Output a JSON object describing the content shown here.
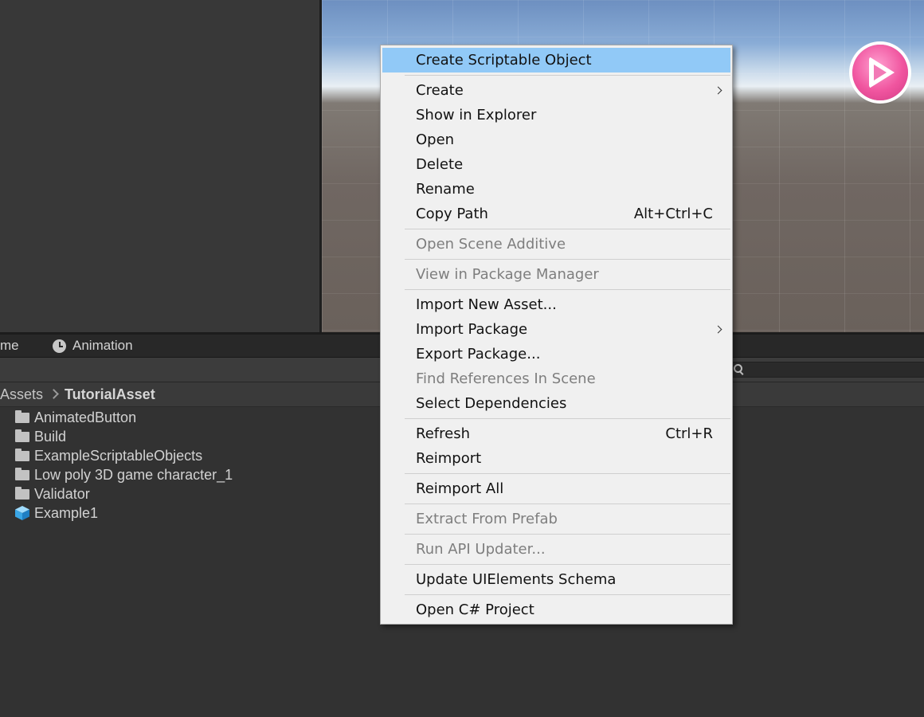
{
  "tabs": {
    "game_label": "me",
    "animation_label": "Animation"
  },
  "breadcrumb": {
    "root": "Assets",
    "current": "TutorialAsset"
  },
  "files": [
    {
      "label": "AnimatedButton",
      "icon": "folder-icon"
    },
    {
      "label": "Build",
      "icon": "folder-icon"
    },
    {
      "label": "ExampleScriptableObjects",
      "icon": "folder-icon"
    },
    {
      "label": "Low poly 3D game character_1",
      "icon": "folder-icon"
    },
    {
      "label": "Validator",
      "icon": "folder-icon"
    },
    {
      "label": "Example1",
      "icon": "cube-icon"
    }
  ],
  "context_menu": {
    "create_scriptable_object": "Create Scriptable Object",
    "create": "Create",
    "show_in_explorer": "Show in Explorer",
    "open": "Open",
    "delete": "Delete",
    "rename": "Rename",
    "copy_path": "Copy Path",
    "copy_path_shortcut": "Alt+Ctrl+C",
    "open_scene_additive": "Open Scene Additive",
    "view_in_package_manager": "View in Package Manager",
    "import_new_asset": "Import New Asset...",
    "import_package": "Import Package",
    "export_package": "Export Package...",
    "find_references_in_scene": "Find References In Scene",
    "select_dependencies": "Select Dependencies",
    "refresh": "Refresh",
    "refresh_shortcut": "Ctrl+R",
    "reimport": "Reimport",
    "reimport_all": "Reimport All",
    "extract_from_prefab": "Extract From Prefab",
    "run_api_updater": "Run API Updater...",
    "update_uielements_schema": "Update UIElements Schema",
    "open_csharp_project": "Open C# Project"
  },
  "colors": {
    "highlight": "#91c9f7",
    "menu_bg": "#f0f0f0",
    "editor_bg": "#323232",
    "play_button": "#f0559f"
  }
}
